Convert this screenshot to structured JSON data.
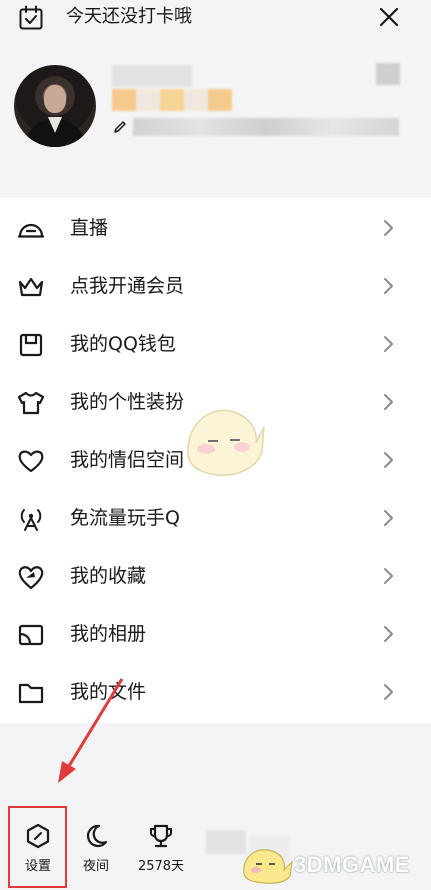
{
  "topbar": {
    "checkin_text": "今天还没打卡哦",
    "close_icon": "close-icon"
  },
  "profile": {
    "edit_icon": "pencil-icon"
  },
  "menu": {
    "items": [
      {
        "label": "直播",
        "icon": "live-icon"
      },
      {
        "label": "点我开通会员",
        "icon": "crown-icon"
      },
      {
        "label": "我的QQ钱包",
        "icon": "wallet-icon"
      },
      {
        "label": "我的个性装扮",
        "icon": "tshirt-icon"
      },
      {
        "label": "我的情侣空间",
        "icon": "heart-icon"
      },
      {
        "label": "免流量玩手Q",
        "icon": "antenna-icon"
      },
      {
        "label": "我的收藏",
        "icon": "favorite-icon"
      },
      {
        "label": "我的相册",
        "icon": "album-icon"
      },
      {
        "label": "我的文件",
        "icon": "folder-icon"
      }
    ]
  },
  "bottombar": {
    "settings_label": "设置",
    "night_label": "夜间",
    "days_label": "2578天"
  },
  "watermark": {
    "text": "3DMGAME"
  },
  "colors": {
    "highlight": "#e23b3b",
    "menu_bg": "#ffffff",
    "page_bg": "#f4f4f6"
  }
}
